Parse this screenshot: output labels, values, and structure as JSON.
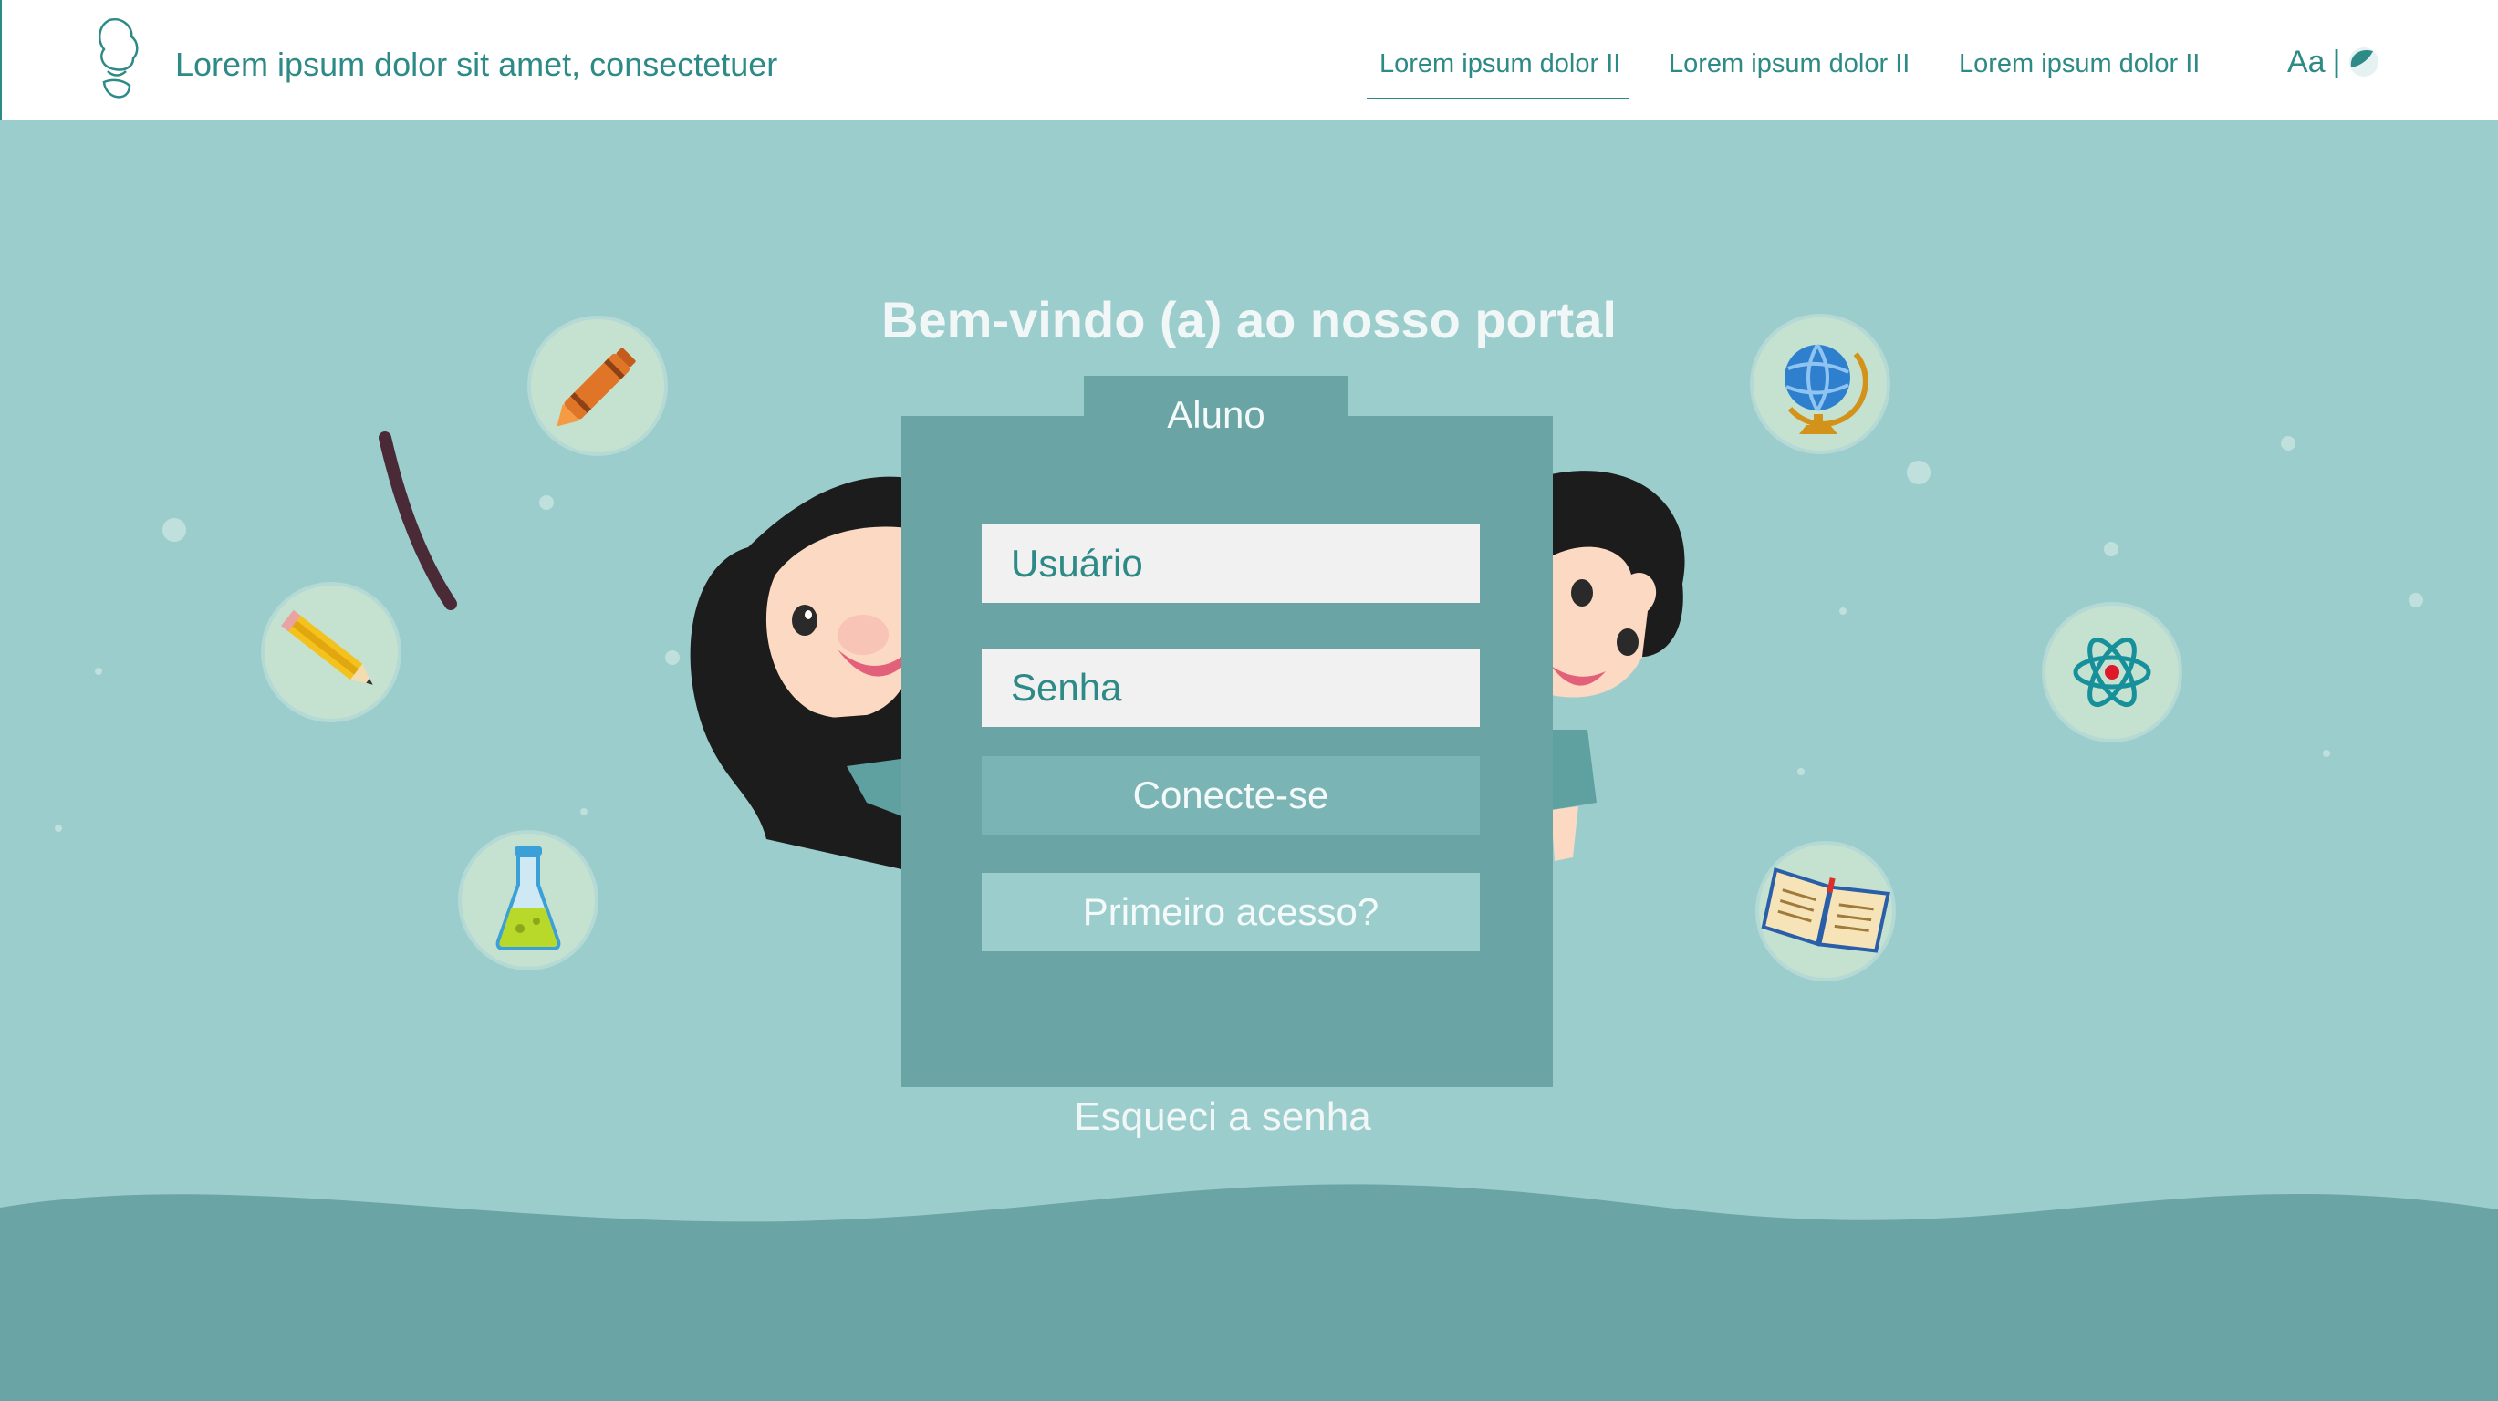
{
  "header": {
    "site_title": "Lorem ipsum dolor sit amet, consectetuer",
    "nav": [
      {
        "label": "Lorem ipsum dolor II",
        "active": true
      },
      {
        "label": "Lorem ipsum dolor II",
        "active": false
      },
      {
        "label": "Lorem ipsum dolor II",
        "active": false
      }
    ],
    "font_toggle": "Aa",
    "separator": "|"
  },
  "main": {
    "welcome": "Bem-vindo (a) ao nosso portal",
    "login": {
      "tab_label": "Aluno",
      "username_placeholder": "Usuário",
      "password_placeholder": "Senha",
      "submit_label": "Conecte-se",
      "first_access_label": "Primeiro acesso?",
      "forgot_label": "Esqueci a senha"
    }
  },
  "decor_icons": [
    "crayon-icon",
    "pencil-icon",
    "flask-icon",
    "globe-icon",
    "atom-icon",
    "book-icon"
  ],
  "colors": {
    "accent": "#2d8a86",
    "background": "#9ccdcd",
    "card": "#6aa4a4",
    "button": "#7bb4b4",
    "header_bg": "#ffffff"
  }
}
